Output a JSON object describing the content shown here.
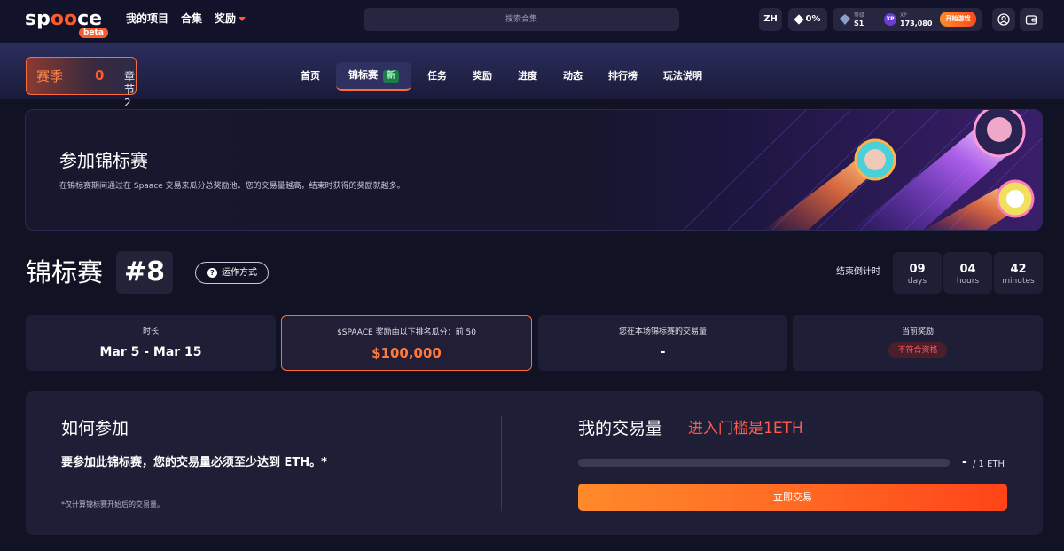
{
  "brand": {
    "logo_text_left": "sp",
    "logo_text_ring": "oo",
    "logo_text_right": "ce",
    "beta_label": "beta"
  },
  "topnav": {
    "projects": "我的项目",
    "collections": "合集",
    "rewards": "奖励"
  },
  "search": {
    "placeholder": "搜索合集"
  },
  "header_right": {
    "language": "ZH",
    "percent": "0%",
    "rank_label": "等级",
    "rank_value": "S1",
    "xp_label": "XP",
    "xp_value": "173,080",
    "xp_icon_text": "XP",
    "start_game": "开始游戏"
  },
  "season": {
    "label": "赛季",
    "number": "0",
    "chapter": "章节 2"
  },
  "tabs": [
    {
      "label": "首页"
    },
    {
      "label": "锦标赛",
      "badge": "新"
    },
    {
      "label": "任务"
    },
    {
      "label": "奖励"
    },
    {
      "label": "进度"
    },
    {
      "label": "动态"
    },
    {
      "label": "排行榜"
    },
    {
      "label": "玩法说明"
    }
  ],
  "hero": {
    "title": "参加锦标赛",
    "description": "在锦标赛期间通过在 Spaace 交易来瓜分总奖励池。您的交易量越高，结束时获得的奖励就越多。"
  },
  "tournament": {
    "title": "锦标赛",
    "number": "#8",
    "how_it_works": "运作方式",
    "info_icon_text": "?",
    "countdown_label": "结束倒计时",
    "countdown": [
      {
        "value": "09",
        "unit": "days"
      },
      {
        "value": "04",
        "unit": "hours"
      },
      {
        "value": "42",
        "unit": "minutes"
      }
    ]
  },
  "stats": {
    "duration_label": "时长",
    "duration_value": "Mar 5 - Mar 15",
    "prize_label": "$SPAACE 奖励由以下排名瓜分：前 50",
    "prize_value": "$100,000",
    "my_volume_label": "您在本场锦标赛的交易量",
    "my_volume_value": "-",
    "current_reward_label": "当前奖励",
    "current_reward_status": "不符合资格"
  },
  "participate": {
    "title": "如何参加",
    "requirement": "要参加此锦标赛，您的交易量必须至少达到 ETH。*",
    "note": "*仅计算锦标赛开始后的交易量。"
  },
  "volume": {
    "title": "我的交易量",
    "threshold": "进入门槛是1ETH",
    "progress_fraction": 0,
    "current": "-",
    "target": "/ 1 ETH",
    "trade_button": "立即交易"
  },
  "colors": {
    "accent": "#ff6a3a",
    "background": "#121225",
    "card": "#1e1e36",
    "danger": "#ff5a4a"
  }
}
